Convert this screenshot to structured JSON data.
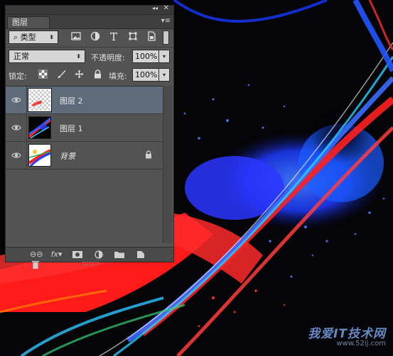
{
  "panel": {
    "tab_label": "图层",
    "filter": {
      "kind_label": "类型"
    },
    "blend": {
      "mode": "正常",
      "opacity_label": "不透明度:",
      "opacity_value": "100%"
    },
    "lock": {
      "label": "锁定:",
      "fill_label": "填充:",
      "fill_value": "100%"
    },
    "layers": [
      {
        "name": "图层 2",
        "selected": true,
        "visible": true
      },
      {
        "name": "图层 1",
        "selected": false,
        "visible": true
      },
      {
        "name": "背景",
        "selected": false,
        "visible": true,
        "locked": true
      }
    ]
  },
  "watermark": {
    "main": "我爱IT技术网",
    "url": "www.52ij.com"
  },
  "colors": {
    "panel_bg": "#535353",
    "selected_row": "#5f6a7a",
    "artwork_red": "#ff1a1a",
    "artwork_blue": "#1f3cff"
  }
}
